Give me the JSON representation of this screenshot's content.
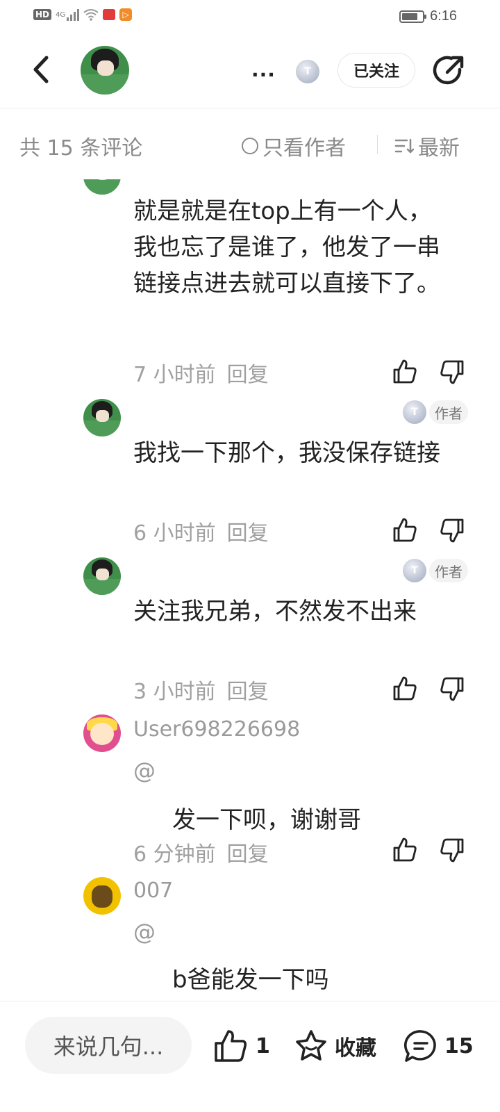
{
  "status_bar": {
    "network": "HD",
    "network_type": "4G",
    "time": "6:16",
    "icons": [
      "hd-icon",
      "signal-icon",
      "wifi-icon",
      "reader-app-icon",
      "video-app-icon",
      "battery-icon"
    ]
  },
  "header": {
    "title": "...",
    "level_badge": "T",
    "follow_label": "已关注"
  },
  "comment_bar": {
    "count_label": "共 15 条评论",
    "only_author_label": "只看作者",
    "sort_label": "最新"
  },
  "comments": [
    {
      "text": "就是就是在top上有一个人，我也忘了是谁了，他发了一串链接点进去就可以直接下了。",
      "time": "7 小时前",
      "reply_label": "回复"
    },
    {
      "text": "我找一下那个，我没保存链接",
      "author_tag": "作者",
      "time": "6 小时前",
      "reply_label": "回复"
    },
    {
      "text": "关注我兄弟，不然发不出来",
      "author_tag": "作者",
      "time": "3 小时前",
      "reply_label": "回复"
    },
    {
      "username": "User698226698",
      "mention": "@",
      "text": "发一下呗，谢谢哥",
      "time": "6 分钟前",
      "reply_label": "回复"
    },
    {
      "username": "007",
      "mention": "@",
      "text": "b爸能发一下吗"
    }
  ],
  "bottom_bar": {
    "input_placeholder": "来说几句...",
    "like_count": "1",
    "favorite_label": "收藏",
    "comment_count": "15"
  }
}
